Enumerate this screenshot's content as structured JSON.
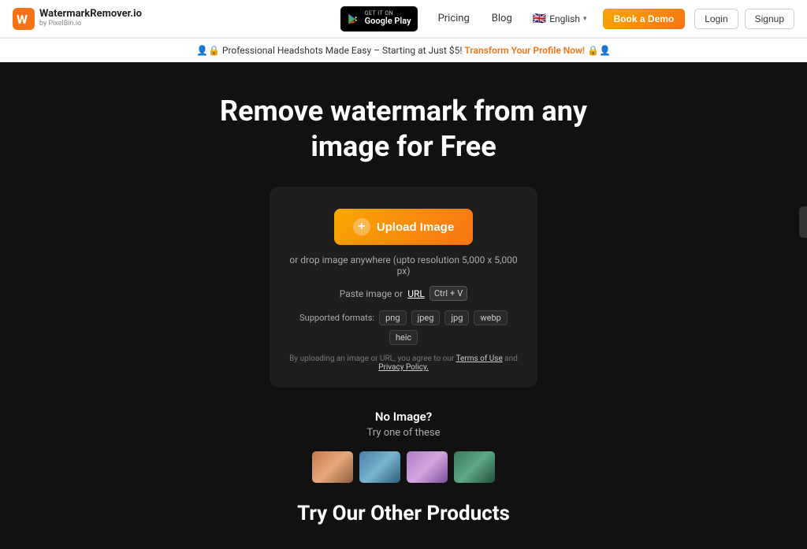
{
  "navbar": {
    "logo_main": "WatermarkRemover.io",
    "logo_sub": "by PixelBin.io",
    "google_play_get_it": "GET IT ON",
    "google_play_name": "Google Play",
    "pricing_label": "Pricing",
    "blog_label": "Blog",
    "language_label": "English",
    "book_demo_label": "Book a Demo",
    "login_label": "Login",
    "signup_label": "Signup"
  },
  "announcement": {
    "text": "Professional Headshots Made Easy – Starting at Just $5!",
    "cta_text": "Transform Your Profile Now!"
  },
  "hero": {
    "title_line1": "Remove watermark from any",
    "title_line2": "image for Free"
  },
  "upload_box": {
    "upload_button_label": "Upload Image",
    "drop_hint": "or drop image anywhere (upto resolution 5,000 x 5,000 px)",
    "paste_label": "Paste image or",
    "paste_url_label": "URL",
    "shortcut_ctrl": "Ctrl",
    "shortcut_plus": "+",
    "shortcut_v": "V",
    "formats_label": "Supported formats:",
    "formats": [
      "png",
      "jpeg",
      "jpg",
      "webp",
      "heic"
    ],
    "tos_prefix": "By uploading an image or URL, you agree to our",
    "tos_link": "Terms of Use",
    "tos_and": "and",
    "privacy_link": "Privacy Policy."
  },
  "sample_section": {
    "title": "No Image?",
    "subtitle": "Try one of these",
    "images": [
      {
        "label": "sample-landscape-1",
        "class": "sample-img-1"
      },
      {
        "label": "sample-landscape-2",
        "class": "sample-img-2"
      },
      {
        "label": "sample-landscape-3",
        "class": "sample-img-3"
      },
      {
        "label": "sample-landscape-4",
        "class": "sample-img-4"
      }
    ]
  },
  "other_products": {
    "title_line1": "Try Our Other Products"
  }
}
